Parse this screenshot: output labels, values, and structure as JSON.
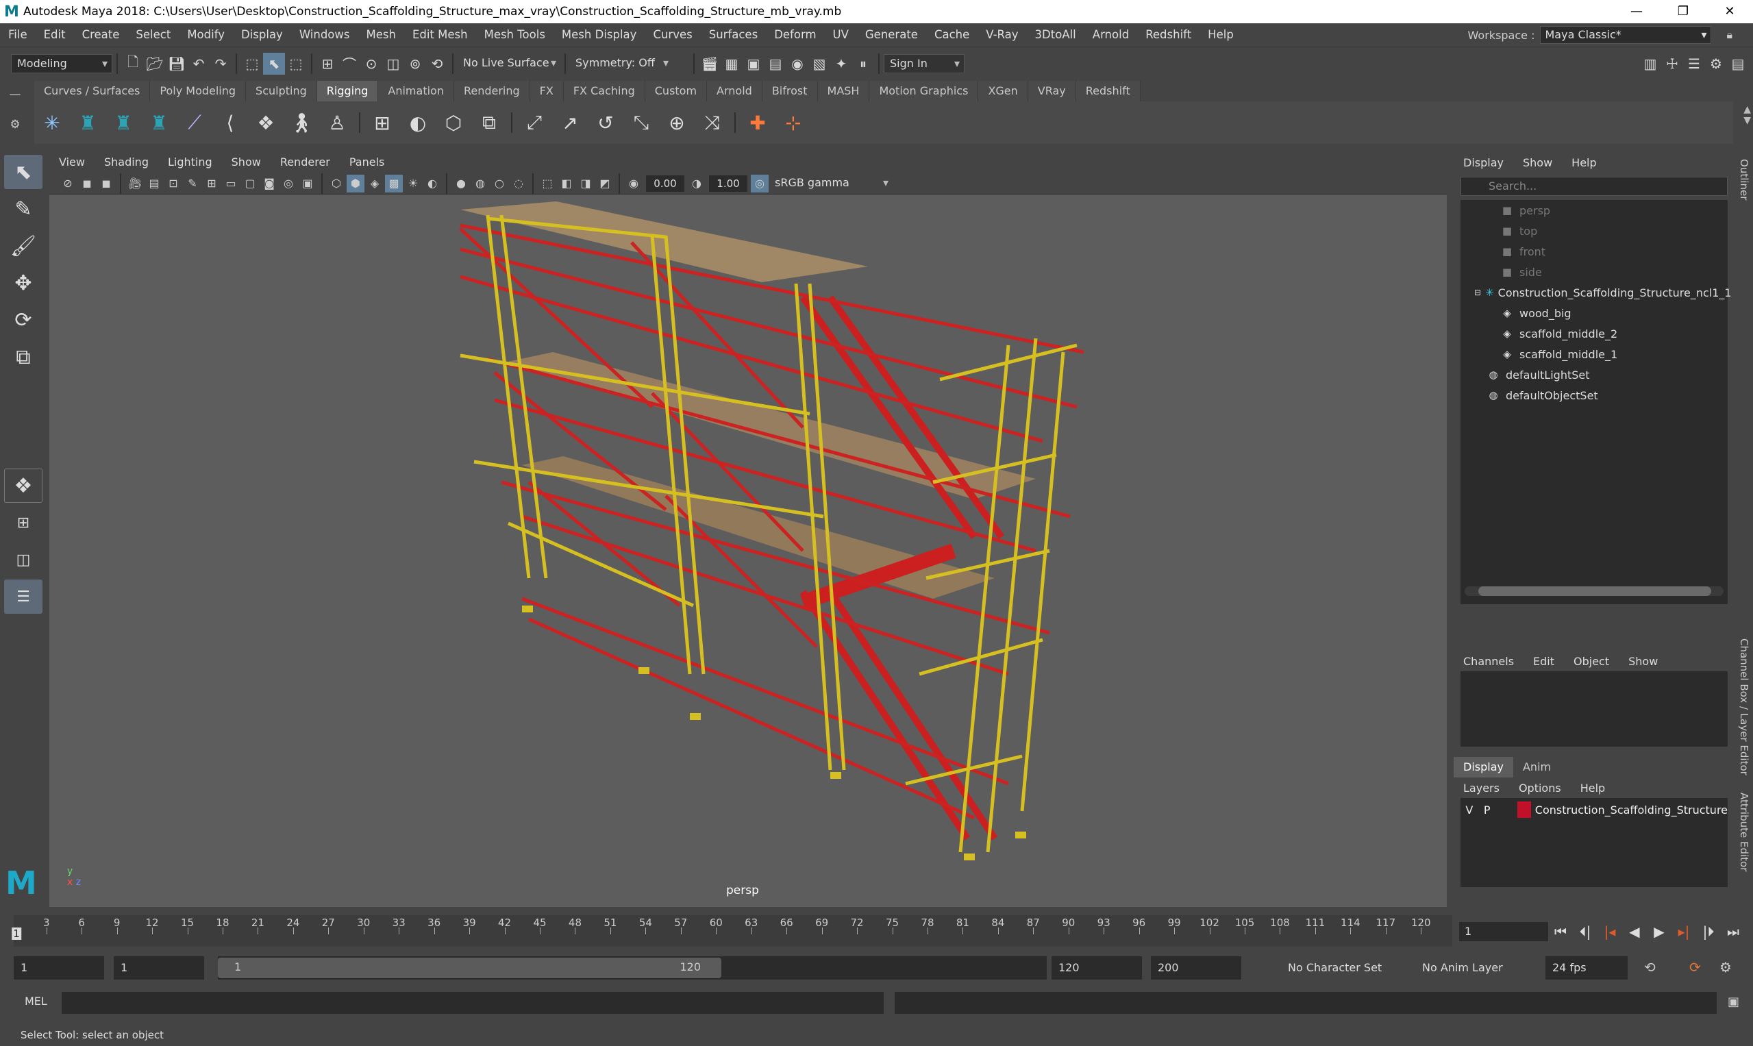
{
  "window": {
    "title": "Autodesk Maya 2018: C:\\Users\\User\\Desktop\\Construction_Scaffolding_Structure_max_vray\\Construction_Scaffolding_Structure_mb_vray.mb",
    "app_icon": "M",
    "minimize": "—",
    "restore": "❐",
    "close": "✕"
  },
  "menubar": {
    "items": [
      "File",
      "Edit",
      "Create",
      "Select",
      "Modify",
      "Display",
      "Windows",
      "Mesh",
      "Edit Mesh",
      "Mesh Tools",
      "Mesh Display",
      "Curves",
      "Surfaces",
      "Deform",
      "UV",
      "Generate",
      "Cache",
      "V-Ray",
      "3DtoAll",
      "Arnold",
      "Redshift",
      "Help"
    ],
    "workspace_label": "Workspace :",
    "workspace_value": "Maya Classic*"
  },
  "statusline": {
    "menuset": "Modeling",
    "live_surface": "No Live Surface",
    "symmetry": "Symmetry: Off",
    "sign_in": "Sign In"
  },
  "shelf": {
    "tabs": [
      "Curves / Surfaces",
      "Poly Modeling",
      "Sculpting",
      "Rigging",
      "Animation",
      "Rendering",
      "FX",
      "FX Caching",
      "Custom",
      "Arnold",
      "Bifrost",
      "MASH",
      "Motion Graphics",
      "XGen",
      "VRay",
      "Redshift"
    ],
    "active_tab": "Rigging"
  },
  "viewport": {
    "menu": [
      "View",
      "Shading",
      "Lighting",
      "Show",
      "Renderer",
      "Panels"
    ],
    "exposure": "0.00",
    "gamma": "1.00",
    "color_space": "sRGB gamma",
    "camera_label": "persp",
    "axis_x": "x",
    "axis_y": "y",
    "axis_z": "z"
  },
  "outliner": {
    "menu": [
      "Display",
      "Show",
      "Help"
    ],
    "search_placeholder": "Search...",
    "items": [
      {
        "label": "persp",
        "dim": true
      },
      {
        "label": "top",
        "dim": true
      },
      {
        "label": "front",
        "dim": true
      },
      {
        "label": "side",
        "dim": true
      },
      {
        "label": "Construction_Scaffolding_Structure_ncl1_1",
        "dim": false
      },
      {
        "label": "wood_big",
        "dim": false
      },
      {
        "label": "scaffold_middle_2",
        "dim": false
      },
      {
        "label": "scaffold_middle_1",
        "dim": false
      },
      {
        "label": "defaultLightSet",
        "dim": false
      },
      {
        "label": "defaultObjectSet",
        "dim": false
      }
    ]
  },
  "channelbox": {
    "menu": [
      "Channels",
      "Edit",
      "Object",
      "Show"
    ]
  },
  "layers": {
    "tabs": [
      "Display",
      "Anim"
    ],
    "active_tab": "Display",
    "menu": [
      "Layers",
      "Options",
      "Help"
    ],
    "row": {
      "v": "V",
      "p": "P",
      "name": "Construction_Scaffolding_Structure",
      "color": "#c0102a"
    }
  },
  "side_tabs": [
    "Outliner",
    "Channel Box / Layer Editor",
    "Attribute Editor"
  ],
  "timeline": {
    "ticks": [
      "3",
      "6",
      "9",
      "12",
      "15",
      "18",
      "21",
      "24",
      "27",
      "30",
      "33",
      "36",
      "39",
      "42",
      "45",
      "48",
      "51",
      "54",
      "57",
      "60",
      "63",
      "66",
      "69",
      "72",
      "75",
      "78",
      "81",
      "84",
      "87",
      "90",
      "93",
      "96",
      "99",
      "102",
      "105",
      "108",
      "111",
      "114",
      "117",
      "120"
    ],
    "current_frame_marker": "1",
    "current_frame": "1"
  },
  "range": {
    "start": "1",
    "playback_start": "1",
    "thumb_start": "1",
    "thumb_end": "120",
    "playback_end": "120",
    "end": "200",
    "character_set": "No Character Set",
    "anim_layer": "No Anim Layer",
    "fps": "24 fps"
  },
  "cmdline": {
    "label": "MEL"
  },
  "helpline": {
    "text": "Select Tool: select an object"
  }
}
